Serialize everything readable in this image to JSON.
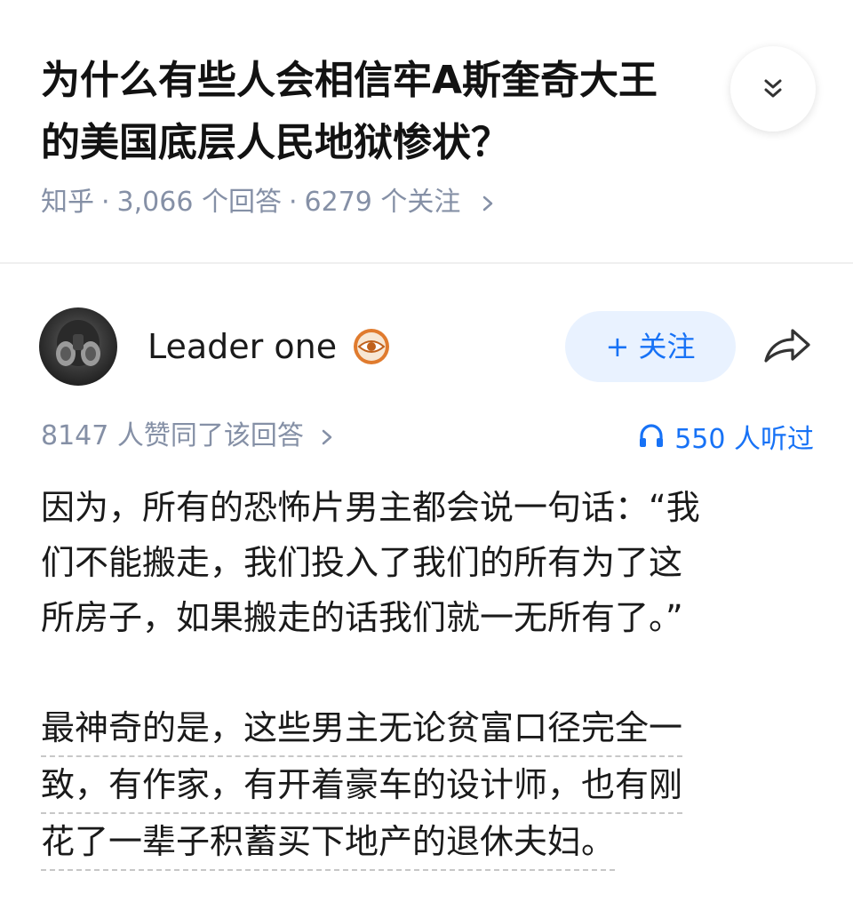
{
  "question": {
    "title_lines": [
      "为什么有些人会相信牢A斯奎奇大王",
      "的美国底层人民地狱惨状？"
    ],
    "meta": {
      "source": "知乎",
      "answers": "3,066 个回答",
      "followers": "6279 个关注"
    },
    "collapse_icon": "double-chevron-down-icon"
  },
  "author": {
    "name": "Leader one",
    "badge_icon": "eye-badge-icon",
    "follow_label": "+ 关注",
    "share_icon": "share-arrow-icon"
  },
  "stats": {
    "votes": "8147 人赞同了该回答",
    "listens": "550 人听过",
    "listen_icon": "headphone-icon"
  },
  "answer": {
    "paragraph1_lines": [
      "因为，所有的恐怖片男主都会说一句话：“我",
      "们不能搬走，我们投入了我们的所有为了这",
      "所房子，如果搬走的话我们就一无所有了。”"
    ],
    "paragraph2_lines": [
      "最神奇的是，这些男主无论贫富口径完全一",
      "致，有作家，有开着豪车的设计师，也有刚",
      "花了一辈子积蓄买下地产的退休夫妇。"
    ]
  },
  "colors": {
    "accent": "#1772f6",
    "follow_bg": "#e9f2ff",
    "meta_gray": "#8590a6",
    "badge_orange": "#e07b2e"
  }
}
